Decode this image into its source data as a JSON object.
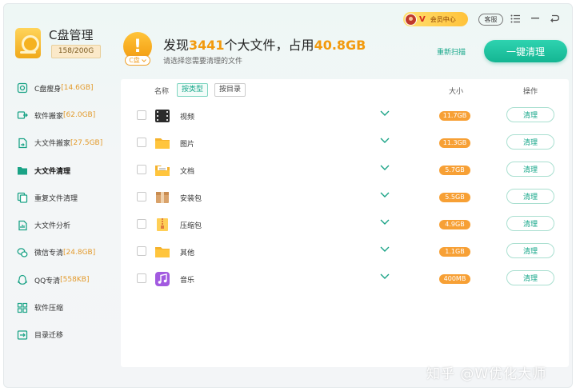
{
  "brand": {
    "title": "C盘管理",
    "usage": "158/200G"
  },
  "titlebar": {
    "vip_label": "会员中心",
    "vip_mark": "V",
    "service_label": "客服"
  },
  "sidebar": {
    "items": [
      {
        "label": "C盘瘦身",
        "size": "[14.6GB]",
        "icon": "disk-slim-icon"
      },
      {
        "label": "软件搬家",
        "size": "[62.0GB]",
        "icon": "software-move-icon"
      },
      {
        "label": "大文件搬家",
        "size": "[27.5GB]",
        "icon": "file-move-icon"
      },
      {
        "label": "大文件清理",
        "size": "",
        "icon": "folder-icon"
      },
      {
        "label": "重复文件清理",
        "size": "",
        "icon": "duplicate-icon"
      },
      {
        "label": "大文件分析",
        "size": "",
        "icon": "analysis-icon"
      },
      {
        "label": "微信专清",
        "size": "[24.8GB]",
        "icon": "wechat-icon"
      },
      {
        "label": "QQ专清",
        "size": "[558KB]",
        "icon": "qq-icon"
      },
      {
        "label": "软件压缩",
        "size": "",
        "icon": "compress-icon"
      },
      {
        "label": "目录迁移",
        "size": "",
        "icon": "migrate-icon"
      }
    ]
  },
  "header": {
    "prefix": "发现",
    "count": "3441",
    "middle": "个大文件，占用",
    "total": "40.8GB",
    "subtitle": "请选择您需要清理的文件",
    "drive_tag": "C盘",
    "rescan_label": "重新扫描",
    "clean_all_label": "一键清理"
  },
  "table": {
    "col_name": "名称",
    "tab_by_type": "按类型",
    "tab_by_dir": "按目录",
    "col_size": "大小",
    "col_op": "操作",
    "rows": [
      {
        "name": "视频",
        "size": "11.7GB",
        "action": "清理",
        "icon": "video-icon"
      },
      {
        "name": "图片",
        "size": "11.3GB",
        "action": "清理",
        "icon": "image-folder-icon"
      },
      {
        "name": "文档",
        "size": "5.7GB",
        "action": "清理",
        "icon": "document-icon"
      },
      {
        "name": "安装包",
        "size": "5.5GB",
        "action": "清理",
        "icon": "package-icon"
      },
      {
        "name": "压缩包",
        "size": "4.9GB",
        "action": "清理",
        "icon": "archive-icon"
      },
      {
        "name": "其他",
        "size": "1.1GB",
        "action": "清理",
        "icon": "other-folder-icon"
      },
      {
        "name": "音乐",
        "size": "400MB",
        "action": "清理",
        "icon": "music-icon"
      }
    ]
  },
  "watermark": "知乎 @W优化大师",
  "colors": {
    "accent": "#17a78a",
    "warning": "#f29a0e",
    "pill": "#f7a035"
  }
}
